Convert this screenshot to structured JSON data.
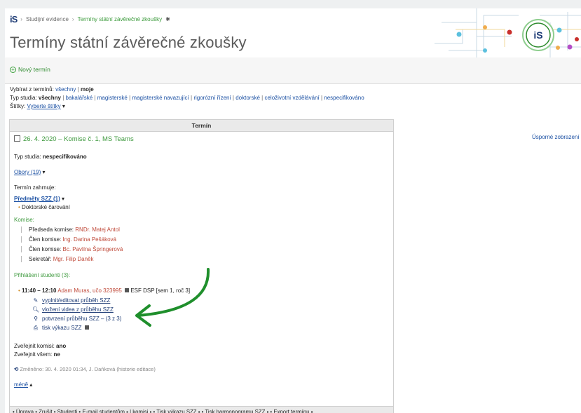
{
  "breadcrumb": {
    "logo": "iS",
    "items": [
      "Studijní evidence",
      "Termíny státní závěrečné zkoušky"
    ],
    "star": "✱"
  },
  "page_title": "Termíny státní závěrečné zkoušky",
  "toolbar": {
    "new_term": "Nový termín"
  },
  "filters": {
    "line1_label": "Vybírat z termínů:",
    "line1_all": "všechny",
    "line1_mine": "moje",
    "line2_label": "Typ studia:",
    "study_types": [
      "všechny",
      "bakalářské",
      "magisterské",
      "magisterské navazující",
      "rigorózní řízení",
      "doktorské",
      "celoživotní vzdělávání",
      "nespecifikováno"
    ],
    "line3_label": "Štítky:",
    "tags_link": "Vyberte štítky"
  },
  "table": {
    "header": "Termín",
    "term_title": "26. 4. 2020 – Komise č. 1, MS Teams",
    "study_type_label": "Typ studia:",
    "study_type_value": "nespecifikováno",
    "obory": "Obory (19)",
    "includes": "Termín zahrnuje:",
    "subjects": "Předměty SZZ (1)",
    "subject_item": "Doktorské čarování",
    "committee_label": "Komise:",
    "committee": [
      {
        "role": "Předseda komise:",
        "name": "RNDr. Matej Antol"
      },
      {
        "role": "Člen komise:",
        "name": "Ing. Darina Pešáková"
      },
      {
        "role": "Člen komise:",
        "name": "Bc. Pavlína Špringerová"
      },
      {
        "role": "Sekretář:",
        "name": "Mgr. Filip Daněk"
      }
    ],
    "registered_label": "Přihlášení studenti (3):",
    "student": {
      "time": "11:40 – 12:10",
      "name": "Adam Muras",
      "uco": "učo 323995",
      "rest": "ESF DSP [sem 1, roč 3]"
    },
    "actions": [
      {
        "icon": "pencil-icon",
        "label": "vyplnit/editovat průběh SZZ"
      },
      {
        "icon": "magnifier-icon",
        "label": "vložení videa z průběhu SZZ"
      },
      {
        "icon": "person-icon",
        "label": "potvrzení průběhu SZZ – (3 z 3)"
      },
      {
        "icon": "printer-icon",
        "label": "tisk výkazu SZZ"
      }
    ],
    "publish_committee_label": "Zveřejnit komisi:",
    "publish_committee_value": "ano",
    "publish_all_label": "Zveřejnit všem:",
    "publish_all_value": "ne",
    "changed": "Změněno: 30. 4. 2020 01:34, J. Daňková (historie editace)",
    "less": "méně",
    "footer": "• Úprava • Zrušit • Studenti • E-mail studentům ▪ | komisi ▪ • Tisk výkazu SZZ ▪ • Tisk harmonogramu SZZ ▪ • Export termínu ▪"
  },
  "compact_view": "Úsporné zobrazení",
  "colors": {
    "accent_green": "#3f9a3f",
    "link_blue": "#1b50a3",
    "arrow_green": "#1f8f2c"
  }
}
